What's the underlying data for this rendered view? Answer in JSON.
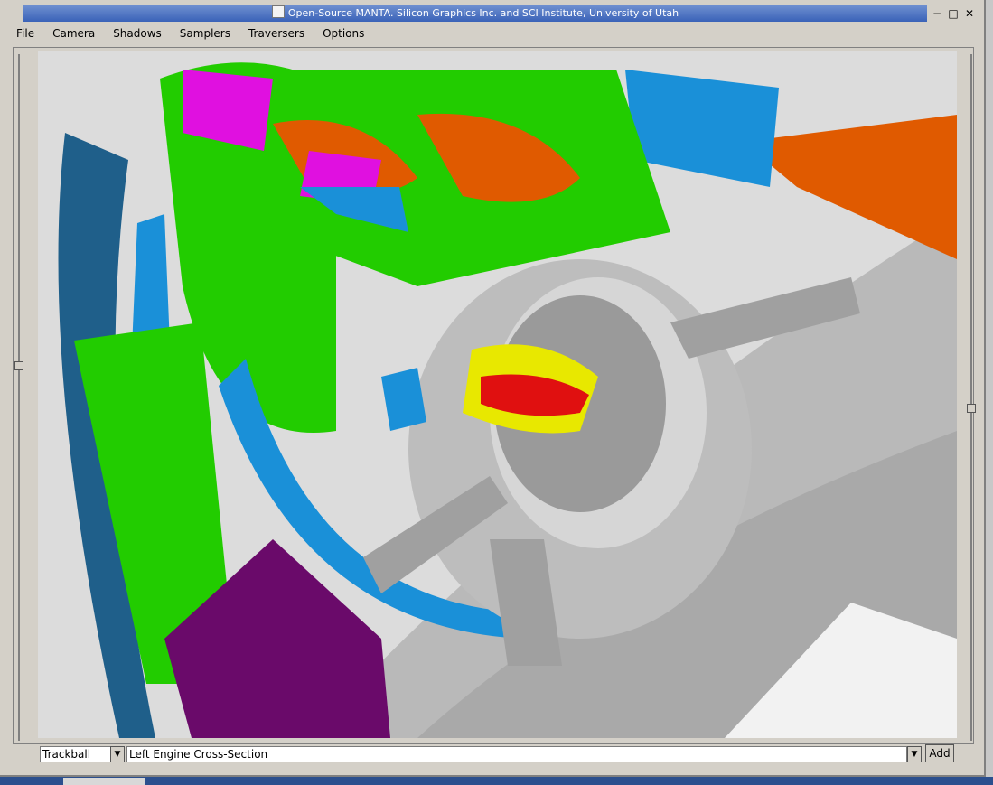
{
  "window": {
    "title": "Open-Source MANTA. Silicon Graphics Inc. and SCI Institute, University of Utah",
    "controls": [
      "−",
      "□",
      "✕"
    ]
  },
  "menu": {
    "items": [
      "File",
      "Camera",
      "Shadows",
      "Samplers",
      "Traversers",
      "Options"
    ]
  },
  "controls": {
    "camera_mode": "Trackball",
    "bookmark": "Left Engine Cross-Section",
    "add_label": "Add",
    "dropdown_icon": "chevron-down-icon"
  },
  "colors": {
    "green": "#22cc00",
    "orange": "#e05a00",
    "magenta": "#e010e0",
    "blue": "#1a90d8",
    "gray": "#b8b8b8",
    "purple": "#6a0a6a"
  }
}
